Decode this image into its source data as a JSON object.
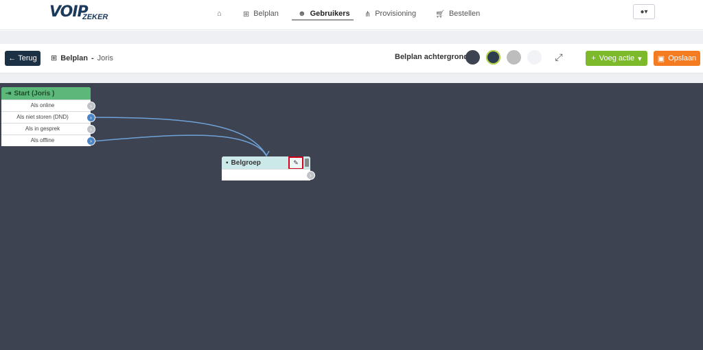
{
  "brand": {
    "logo_main": "VOIP",
    "logo_sub": "ZEKER"
  },
  "nav": {
    "home_icon": "home-icon",
    "items": [
      {
        "label": "Belplan",
        "icon": "sitemap-icon"
      },
      {
        "label": "Gebruikers",
        "icon": "users-icon",
        "active": true
      },
      {
        "label": "Provisioning",
        "icon": "network-icon"
      },
      {
        "label": "Bestellen",
        "icon": "cart-icon"
      }
    ],
    "user_menu_icon": "user-icon"
  },
  "toolbar": {
    "back_label": "Terug",
    "breadcrumb_title": "Belplan",
    "breadcrumb_separator": "-",
    "breadcrumb_sub": "Joris",
    "background_label": "Belplan achtergrond",
    "swatches": [
      "#3d4350",
      "#2e3d4e",
      "#bdbdbd",
      "#f2f3f7"
    ],
    "add_label": "Voeg actie",
    "save_label": "Opslaan",
    "colors": {
      "back": "#1d3144",
      "add": "#7cba2c",
      "save": "#f47b20"
    }
  },
  "canvas": {
    "background": "#3d4350",
    "start_node": {
      "title": "Start (Joris )",
      "rows": [
        "Als online",
        "Als niet storen (DND)",
        "Als in gesprek",
        "Als offline"
      ]
    },
    "bel_node": {
      "title": "Belgroep"
    }
  }
}
